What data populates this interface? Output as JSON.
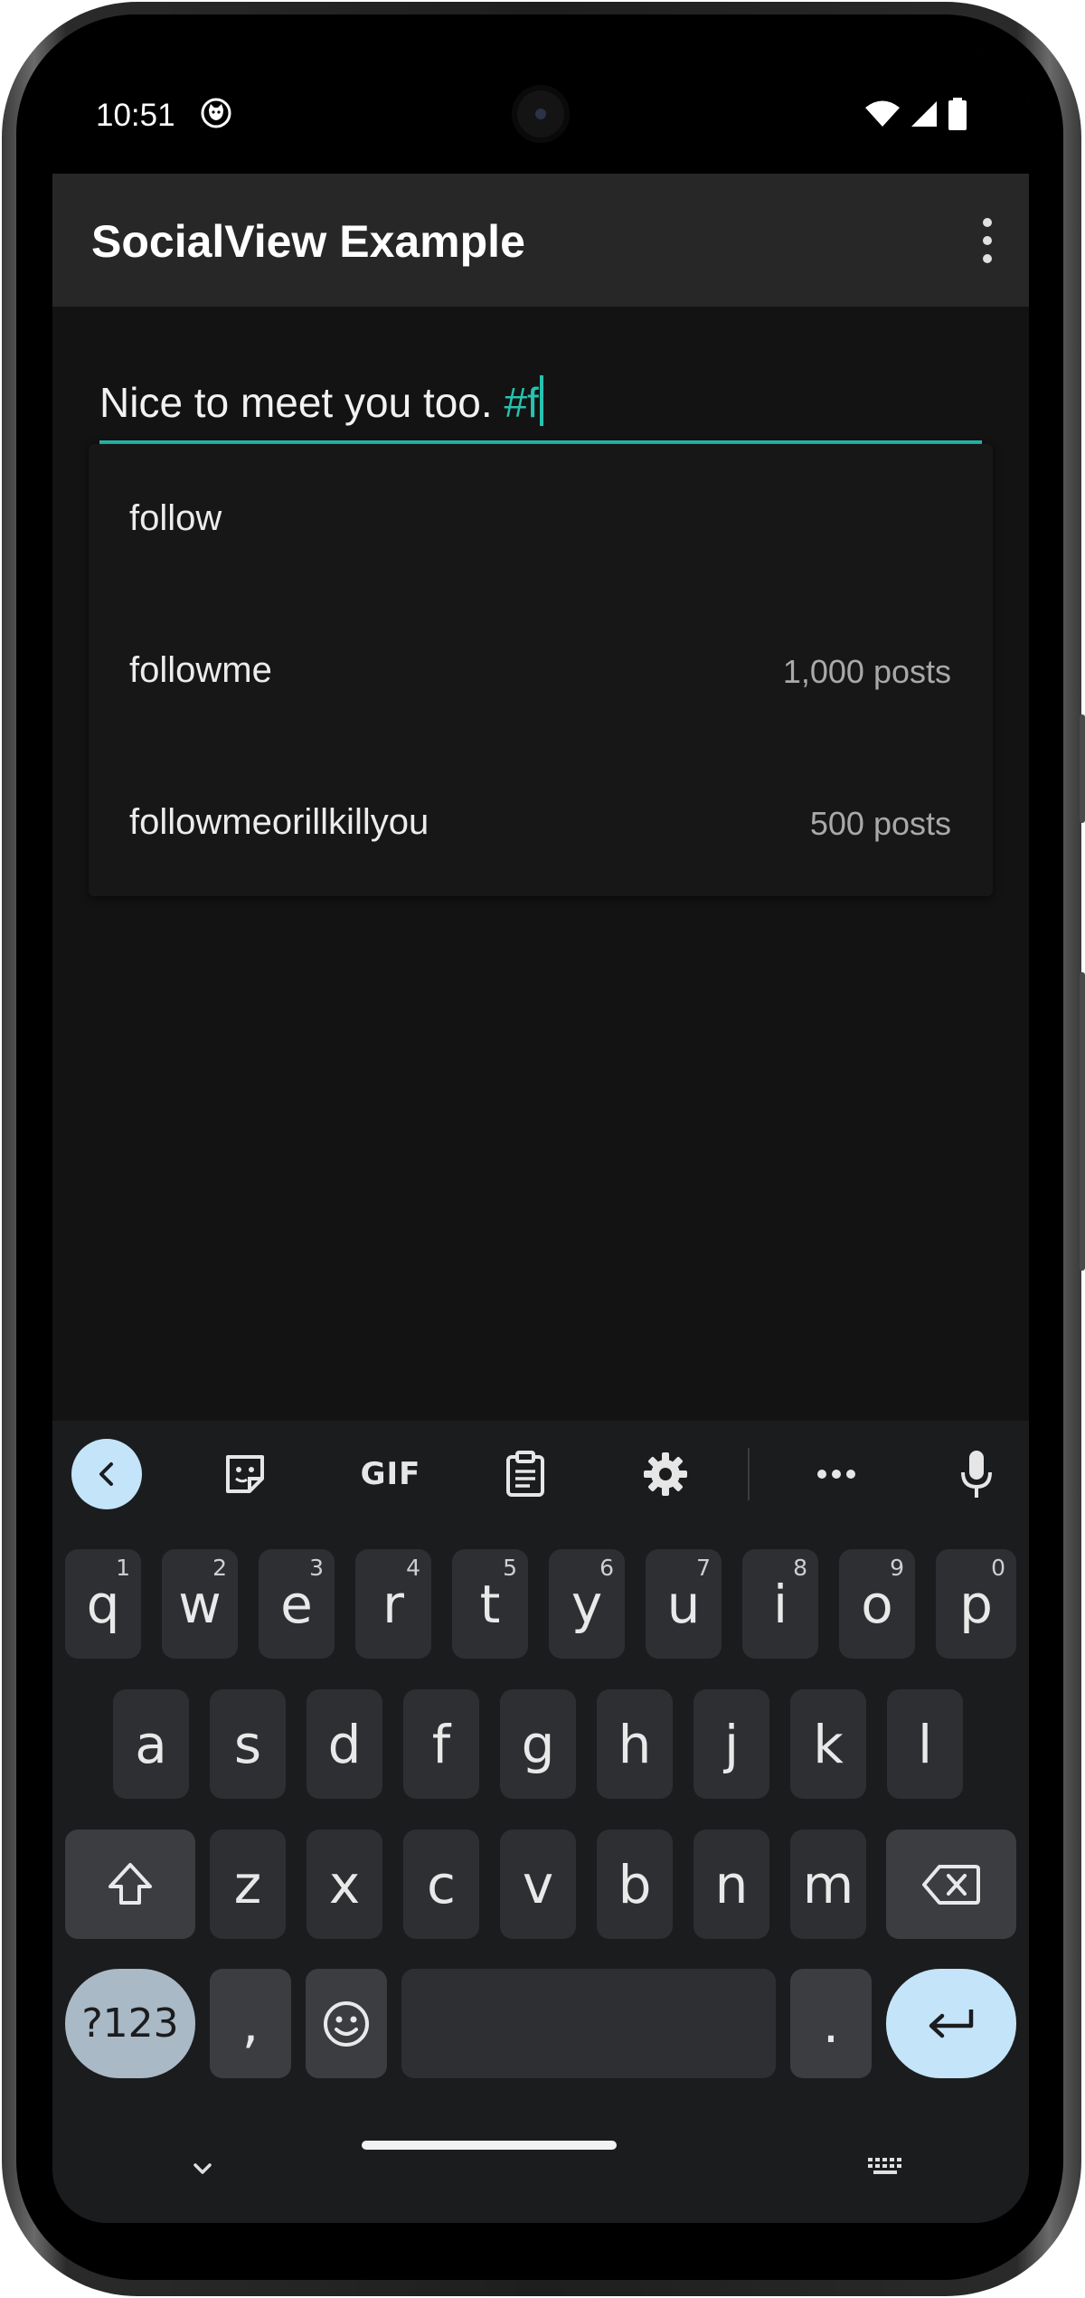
{
  "status_bar": {
    "time": "10:51",
    "icons": [
      "cat-notification-icon",
      "wifi-icon",
      "signal-icon",
      "battery-icon"
    ]
  },
  "app_bar": {
    "title": "SocialView Example",
    "overflow_icon": "more-vert-icon"
  },
  "editor": {
    "text_plain": "Nice to meet you too. ",
    "text_hashtag": "#f",
    "accent_color": "#27c2b0"
  },
  "suggestions": [
    {
      "name": "follow",
      "count": ""
    },
    {
      "name": "followme",
      "count": "1,000 posts"
    },
    {
      "name": "followmeorillkillyou",
      "count": "500 posts"
    }
  ],
  "keyboard": {
    "toolbar": [
      "back-chevron-icon",
      "sticker-icon",
      "gif-icon",
      "clipboard-icon",
      "settings-gear-icon",
      "more-horiz-icon",
      "microphone-icon"
    ],
    "gif_label": "GIF",
    "row1": [
      {
        "k": "q",
        "h": "1"
      },
      {
        "k": "w",
        "h": "2"
      },
      {
        "k": "e",
        "h": "3"
      },
      {
        "k": "r",
        "h": "4"
      },
      {
        "k": "t",
        "h": "5"
      },
      {
        "k": "y",
        "h": "6"
      },
      {
        "k": "u",
        "h": "7"
      },
      {
        "k": "i",
        "h": "8"
      },
      {
        "k": "o",
        "h": "9"
      },
      {
        "k": "p",
        "h": "0"
      }
    ],
    "row2": [
      "a",
      "s",
      "d",
      "f",
      "g",
      "h",
      "j",
      "k",
      "l"
    ],
    "row3": [
      "z",
      "x",
      "c",
      "v",
      "b",
      "n",
      "m"
    ],
    "symbols_label": "?123",
    "comma": ",",
    "period": "."
  },
  "colors": {
    "background": "#131313",
    "app_bar": "#272727",
    "keyboard": "#1b1c1e",
    "key": "#2e2f32",
    "key_accent": "#c4e4fa"
  }
}
